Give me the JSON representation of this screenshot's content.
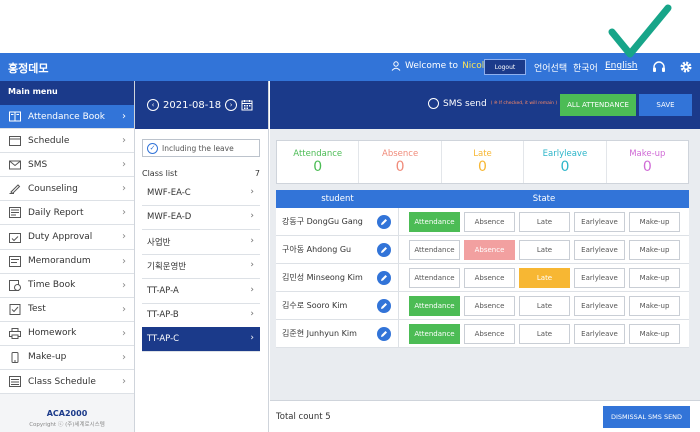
{
  "header": {
    "brand": "홍정데모",
    "welcome_prefix": "Welcome to",
    "user_name": "Nicole",
    "logout_label": "Logout",
    "lang_select": "언어선택",
    "lang_korean": "한국어",
    "lang_english": "English"
  },
  "sidebar": {
    "title": "Main menu",
    "items": [
      {
        "label": "Attendance Book",
        "icon": "book-icon"
      },
      {
        "label": "Schedule",
        "icon": "calendar-icon"
      },
      {
        "label": "SMS",
        "icon": "envelope-icon"
      },
      {
        "label": "Counseling",
        "icon": "pen-icon"
      },
      {
        "label": "Daily Report",
        "icon": "report-icon"
      },
      {
        "label": "Duty Approval",
        "icon": "calendar-check-icon"
      },
      {
        "label": "Memorandum",
        "icon": "memo-icon"
      },
      {
        "label": "Time Book",
        "icon": "time-book-icon"
      },
      {
        "label": "Test",
        "icon": "test-icon"
      },
      {
        "label": "Homework",
        "icon": "printer-icon"
      },
      {
        "label": "Make-up",
        "icon": "phone-icon"
      },
      {
        "label": "Class Schedule",
        "icon": "list-icon"
      }
    ],
    "footer_logo": "ACA2000",
    "footer_copy": "Copyright ⓒ (주)세계로시스템"
  },
  "classes": {
    "date": "2021-08-18",
    "including_leave": "Including the leave",
    "list_label": "Class list",
    "list_count": "7",
    "items": [
      "MWF-EA-C",
      "MWF-EA-D",
      "사업반",
      "기획운영반",
      "TT-AP-A",
      "TT-AP-B",
      "TT-AP-C"
    ],
    "active_index": 6
  },
  "toolbar": {
    "sms_send": "SMS send",
    "sms_note": "( ※ If checked, it will remain )",
    "all_attendance": "ALL ATTENDANCE",
    "save": "SAVE"
  },
  "summary": [
    {
      "label": "Attendance",
      "value": "0",
      "color": "#4cbc55"
    },
    {
      "label": "Absence",
      "value": "0",
      "color": "#f08b7a"
    },
    {
      "label": "Late",
      "value": "0",
      "color": "#f7b733"
    },
    {
      "label": "Earlyleave",
      "value": "0",
      "color": "#2bb5c9"
    },
    {
      "label": "Make-up",
      "value": "0",
      "color": "#d06bd6"
    }
  ],
  "table": {
    "col_student": "student",
    "col_state": "State",
    "state_labels": [
      "Attendance",
      "Absence",
      "Late",
      "Earlyleave",
      "Make-up"
    ],
    "rows": [
      {
        "name": "강동구 DongGu Gang",
        "state": "Attendance"
      },
      {
        "name": "구아동 Ahdong Gu",
        "state": "Absence"
      },
      {
        "name": "김민성 Minseong Kim",
        "state": "Late"
      },
      {
        "name": "김수로 Sooro Kim",
        "state": "Attendance"
      },
      {
        "name": "김준현 Junhyun Kim",
        "state": "Attendance"
      }
    ]
  },
  "footer": {
    "total_count": "Total count 5",
    "dismissal": "DISMISSAL SMS SEND"
  },
  "colors": {
    "brand_blue": "#3274d8",
    "navy": "#1b3a8a",
    "green": "#4cbc55",
    "check_mark": "#17a589"
  }
}
